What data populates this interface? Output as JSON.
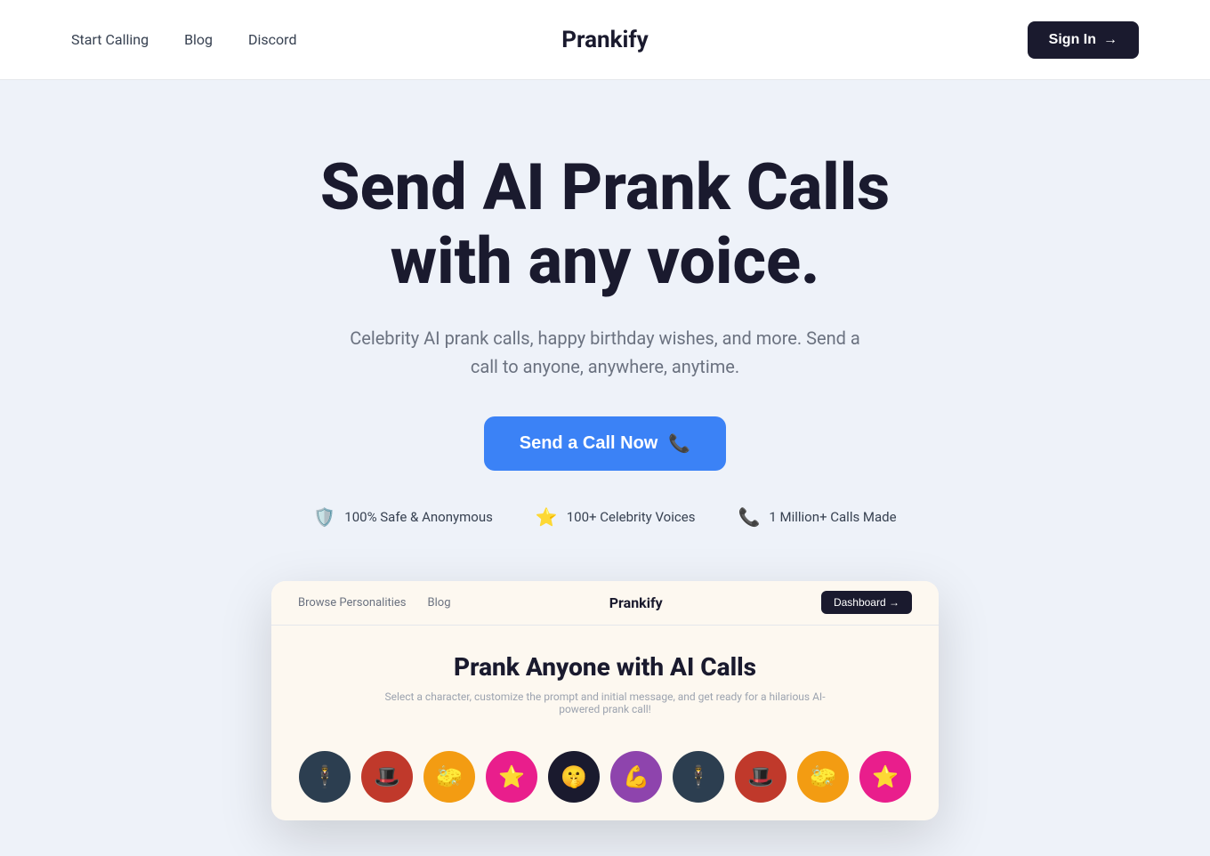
{
  "navbar": {
    "logo": "Prankify",
    "links": [
      {
        "label": "Start Calling",
        "id": "start-calling"
      },
      {
        "label": "Blog",
        "id": "blog"
      },
      {
        "label": "Discord",
        "id": "discord"
      }
    ],
    "sign_in_label": "Sign In",
    "sign_in_arrow": "→"
  },
  "hero": {
    "title_line1": "Send AI Prank Calls",
    "title_line2": "with any voice.",
    "subtitle": "Celebrity AI prank calls, happy birthday wishes, and more. Send a call to anyone, anywhere, anytime.",
    "cta_label": "Send a Call Now",
    "cta_phone_icon": "📞"
  },
  "stats": [
    {
      "id": "safe",
      "icon": "🛡️",
      "icon_class": "stat-icon-shield",
      "label": "100% Safe & Anonymous"
    },
    {
      "id": "voices",
      "icon": "⭐",
      "icon_class": "stat-icon-star",
      "label": "100+ Celebrity Voices"
    },
    {
      "id": "calls",
      "icon": "📞",
      "icon_class": "stat-icon-phone",
      "label": "1 Million+ Calls Made"
    }
  ],
  "preview": {
    "nav_links": [
      {
        "label": "Browse Personalities"
      },
      {
        "label": "Blog"
      }
    ],
    "logo": "Prankify",
    "dashboard_btn": "Dashboard →",
    "title": "Prank Anyone with AI Calls",
    "subtitle": "Select a character, customize the prompt and initial message, and get ready for a hilarious AI-powered prank call!",
    "avatars": [
      {
        "id": "av1",
        "emoji": "🕴",
        "color_class": "avatar-1"
      },
      {
        "id": "av2",
        "emoji": "🎩",
        "color_class": "avatar-2"
      },
      {
        "id": "av3",
        "emoji": "🧽",
        "color_class": "avatar-3"
      },
      {
        "id": "av4",
        "emoji": "⭐",
        "color_class": "avatar-4"
      },
      {
        "id": "av5",
        "emoji": "🤫",
        "color_class": "avatar-5"
      },
      {
        "id": "av6",
        "emoji": "💪",
        "color_class": "avatar-6"
      },
      {
        "id": "av7",
        "emoji": "🕴",
        "color_class": "avatar-7"
      },
      {
        "id": "av8",
        "emoji": "🎩",
        "color_class": "avatar-8"
      },
      {
        "id": "av9",
        "emoji": "🧽",
        "color_class": "avatar-9"
      },
      {
        "id": "av10",
        "emoji": "⭐",
        "color_class": "avatar-10"
      }
    ]
  }
}
